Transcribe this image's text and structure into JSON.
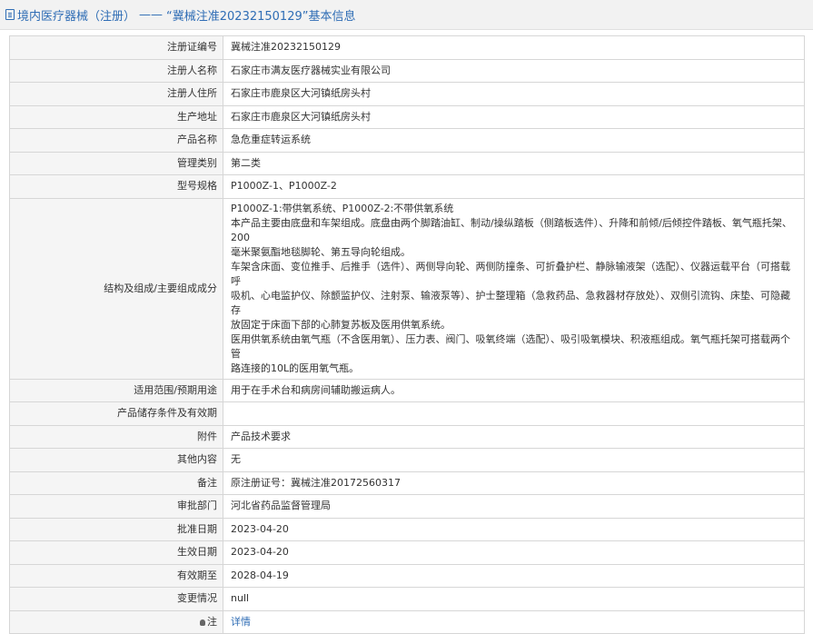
{
  "header": {
    "category": "境内医疗器械（注册）",
    "separator": "——",
    "title": "“冀械注准20232150129”基本信息"
  },
  "rows": [
    {
      "label": "注册证编号",
      "value": "冀械注准20232150129"
    },
    {
      "label": "注册人名称",
      "value": "石家庄市满友医疗器械实业有限公司"
    },
    {
      "label": "注册人住所",
      "value": "石家庄市鹿泉区大河镇纸房头村"
    },
    {
      "label": "生产地址",
      "value": "石家庄市鹿泉区大河镇纸房头村"
    },
    {
      "label": "产品名称",
      "value": "急危重症转运系统"
    },
    {
      "label": "管理类别",
      "value": "第二类"
    },
    {
      "label": "型号规格",
      "value": "P1000Z-1、P1000Z-2"
    }
  ],
  "structure": {
    "label": "结构及组成/主要组成成分",
    "lines": [
      "P1000Z-1:带供氧系统、P1000Z-2:不带供氧系统",
      "本产品主要由底盘和车架组成。底盘由两个脚踏油缸、制动/操纵踏板（侧踏板选件）、升降和前倾/后倾控件踏板、氧气瓶托架、200",
      "毫米聚氨酯地毯脚轮、第五导向轮组成。",
      "车架含床面、变位推手、后推手（选件）、两侧导向轮、两侧防撞条、可折叠护栏、静脉输液架（选配）、仪器运载平台（可搭载呼",
      "吸机、心电监护仪、除颤监护仪、注射泵、输液泵等）、护士整理箱（急救药品、急救器材存放处）、双侧引流钩、床垫、可隐藏存",
      "放固定于床面下部的心肺复苏板及医用供氧系统。",
      "医用供氧系统由氧气瓶（不含医用氧）、压力表、阀门、吸氧终端（选配）、吸引吸氧模块、积液瓶组成。氧气瓶托架可搭载两个管",
      "路连接的10L的医用氧气瓶。"
    ]
  },
  "rows2": [
    {
      "label": "适用范围/预期用途",
      "value": "用于在手术台和病房间辅助搬运病人。"
    },
    {
      "label": "产品储存条件及有效期",
      "value": ""
    },
    {
      "label": "附件",
      "value": "产品技术要求"
    },
    {
      "label": "其他内容",
      "value": "无"
    },
    {
      "label": "备注",
      "value": "原注册证号：冀械注准20172560317"
    },
    {
      "label": "审批部门",
      "value": "河北省药品监督管理局"
    },
    {
      "label": "批准日期",
      "value": "2023-04-20"
    },
    {
      "label": "生效日期",
      "value": "2023-04-20"
    },
    {
      "label": "有效期至",
      "value": "2028-04-19"
    },
    {
      "label": "变更情况",
      "value": "null"
    }
  ],
  "note": {
    "label": "注",
    "link_text": "详情",
    "icon": "bulb-icon"
  }
}
